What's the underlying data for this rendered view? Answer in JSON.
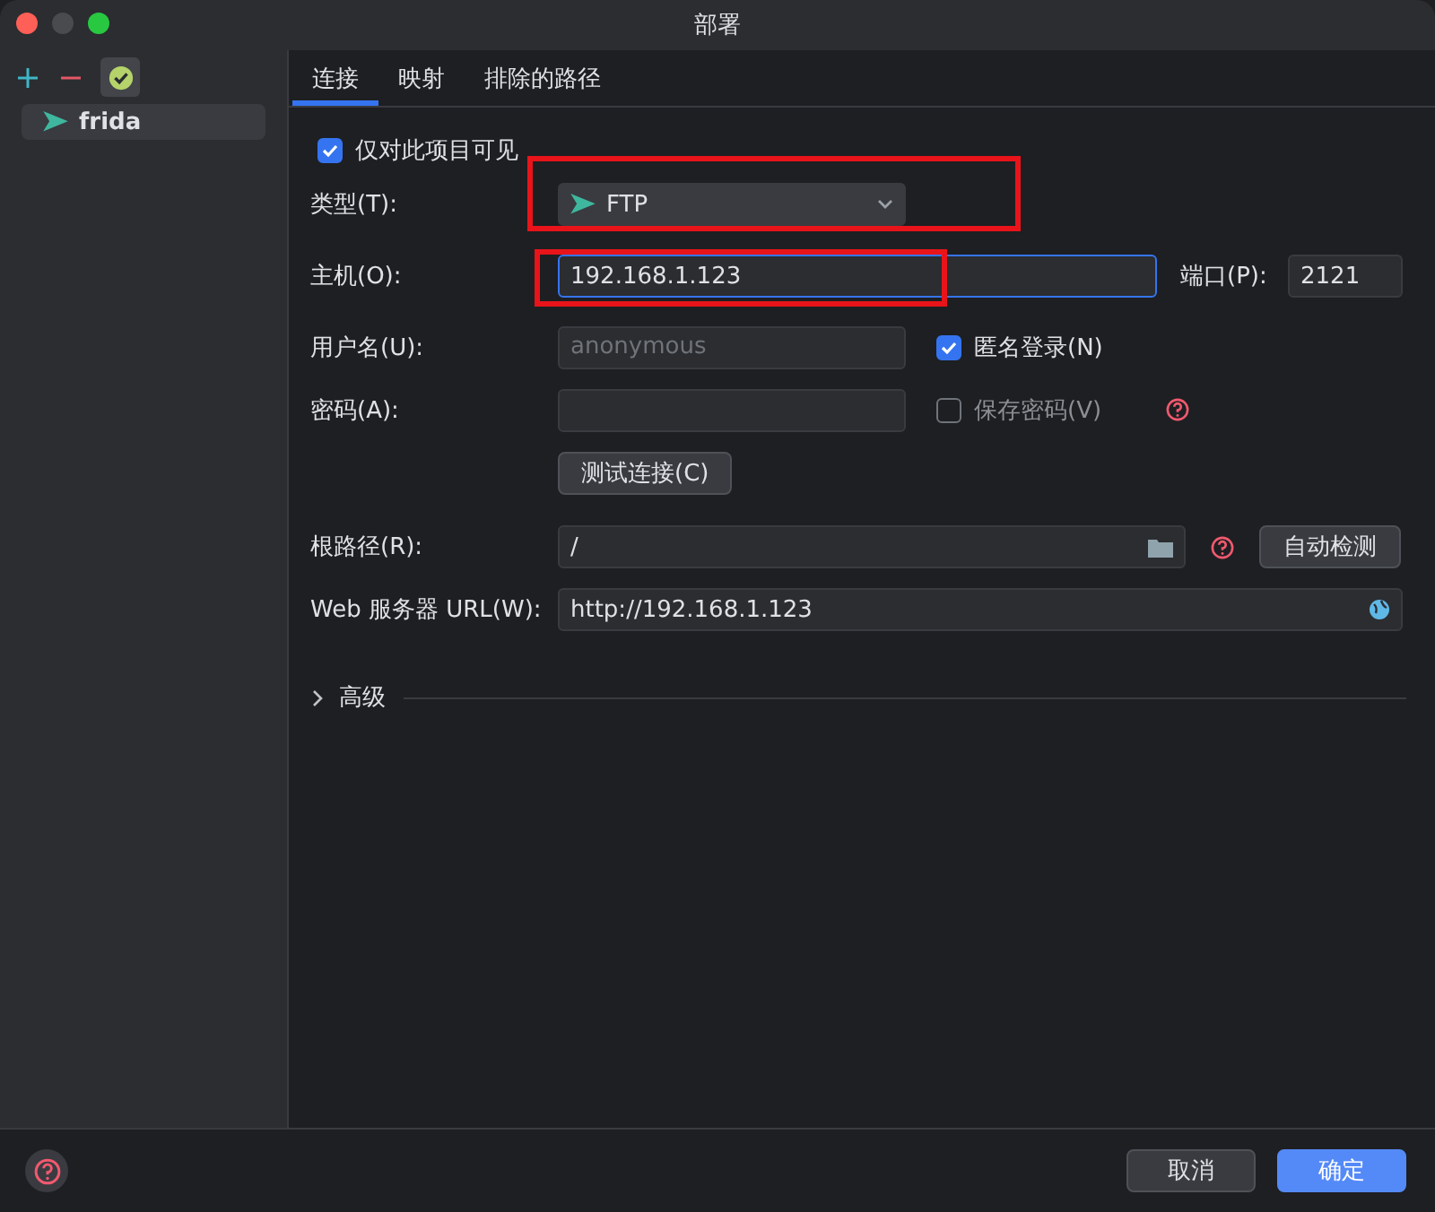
{
  "window": {
    "title": "部署"
  },
  "sidebar": {
    "items": [
      {
        "label": "frida",
        "selected": true
      }
    ]
  },
  "tabs": [
    {
      "label": "连接",
      "selected": true
    },
    {
      "label": "映射",
      "selected": false
    },
    {
      "label": "排除的路径",
      "selected": false
    }
  ],
  "visible_only_this_project": {
    "label": "仅对此项目可见",
    "checked": true
  },
  "type": {
    "label": "类型(T):",
    "value": "FTP",
    "highlighted": true
  },
  "host": {
    "label": "主机(O):",
    "value": "192.168.1.123",
    "highlighted": true
  },
  "port": {
    "label": "端口(P):",
    "value": "2121"
  },
  "username": {
    "label": "用户名(U):",
    "placeholder": "anonymous"
  },
  "anonymous_login": {
    "label": "匿名登录(N)",
    "checked": true
  },
  "password": {
    "label": "密码(A):"
  },
  "save_password": {
    "label": "保存密码(V)",
    "checked": false
  },
  "test_button": "测试连接(C)",
  "root_path": {
    "label": "根路径(R):",
    "value": "/"
  },
  "autodetect_button": "自动检测",
  "web_url": {
    "label": "Web 服务器 URL(W):",
    "value": "http://192.168.1.123"
  },
  "advanced": {
    "label": "高级",
    "expanded": false
  },
  "buttons": [
    {
      "label": "取消",
      "primary": false
    },
    {
      "label": "确定",
      "primary": true
    }
  ]
}
